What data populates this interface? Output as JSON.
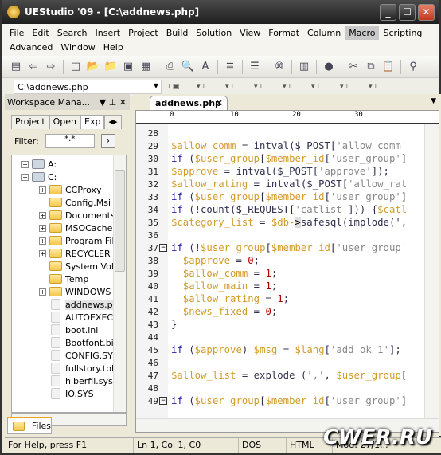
{
  "window": {
    "title": "UEStudio '09 - [C:\\addnews.php]",
    "min": "_",
    "max": "☐",
    "close": "✕"
  },
  "menu": {
    "row1": [
      "File",
      "Edit",
      "Search",
      "Insert",
      "Project",
      "Build",
      "Solution",
      "View",
      "Format",
      "Column",
      "Macro",
      "Scripting"
    ],
    "row2": [
      "Advanced",
      "Window",
      "Help"
    ],
    "active": "Macro"
  },
  "toolbar": {
    "icons": [
      "workspace-icon",
      "back-icon",
      "forward-icon",
      "new-file-icon",
      "open-icon",
      "open-folder-icon",
      "save-icon",
      "save-all-icon",
      "print-icon",
      "print-preview-icon",
      "spell-check-icon",
      "document-icon",
      "wrap-icon",
      "hex-icon",
      "column-icon",
      "web-icon",
      "cut-icon",
      "copy-icon",
      "paste-icon",
      "find-icon"
    ],
    "file_combo": "C:\\addnews.php"
  },
  "workspace": {
    "title": "Workspace Mana...",
    "tabs": [
      "Project",
      "Open",
      "Exp"
    ],
    "filter_label": "Filter:",
    "filter_value": "*.*",
    "tree": [
      {
        "label": "A:",
        "type": "drive",
        "depth": 0,
        "exp": "+"
      },
      {
        "label": "C:",
        "type": "drive",
        "depth": 0,
        "exp": "-"
      },
      {
        "label": "CCProxy",
        "type": "folder",
        "depth": 1,
        "exp": "+"
      },
      {
        "label": "Config.Msi",
        "type": "folder",
        "depth": 1,
        "exp": ""
      },
      {
        "label": "Documents a",
        "type": "folder",
        "depth": 1,
        "exp": "+"
      },
      {
        "label": "MSOCache",
        "type": "folder",
        "depth": 1,
        "exp": "+"
      },
      {
        "label": "Program File",
        "type": "folder",
        "depth": 1,
        "exp": "+"
      },
      {
        "label": "RECYCLER",
        "type": "folder",
        "depth": 1,
        "exp": "+"
      },
      {
        "label": "System Volui",
        "type": "folder",
        "depth": 1,
        "exp": ""
      },
      {
        "label": "Temp",
        "type": "folder",
        "depth": 1,
        "exp": ""
      },
      {
        "label": "WINDOWS",
        "type": "folder",
        "depth": 1,
        "exp": "+"
      },
      {
        "label": "addnews.ph",
        "type": "file",
        "depth": 1,
        "exp": "",
        "selected": true
      },
      {
        "label": "AUTOEXEC.E",
        "type": "file",
        "depth": 1,
        "exp": ""
      },
      {
        "label": "boot.ini",
        "type": "file",
        "depth": 1,
        "exp": ""
      },
      {
        "label": "Bootfont.bin",
        "type": "file",
        "depth": 1,
        "exp": ""
      },
      {
        "label": "CONFIG.SYS",
        "type": "file",
        "depth": 1,
        "exp": ""
      },
      {
        "label": "fullstory.tpl",
        "type": "file",
        "depth": 1,
        "exp": ""
      },
      {
        "label": "hiberfil.sys",
        "type": "file",
        "depth": 1,
        "exp": ""
      },
      {
        "label": "IO.SYS",
        "type": "file",
        "depth": 1,
        "exp": ""
      }
    ],
    "bottom_tab": "Files"
  },
  "editor": {
    "tab": "addnews.php",
    "ruler": [
      "0",
      "10",
      "20",
      "30"
    ],
    "lines": [
      {
        "n": "28",
        "t": []
      },
      {
        "n": "29",
        "t": [
          [
            "$allow_comm",
            "v"
          ],
          [
            " = ",
            "p"
          ],
          [
            "intval($_POST[",
            "p"
          ],
          [
            "'allow_comm'",
            "s"
          ]
        ]
      },
      {
        "n": "30",
        "t": [
          [
            "if",
            "k"
          ],
          [
            " (",
            "p"
          ],
          [
            "$user_group",
            "v"
          ],
          [
            "[",
            "p"
          ],
          [
            "$member_id",
            "v"
          ],
          [
            "[",
            "p"
          ],
          [
            "'user_group'",
            "s"
          ],
          [
            "]",
            "p"
          ]
        ]
      },
      {
        "n": "31",
        "t": [
          [
            "$approve",
            "v"
          ],
          [
            " = ",
            "p"
          ],
          [
            "intval($_POST[",
            "p"
          ],
          [
            "'approve'",
            "s"
          ],
          [
            "]);",
            "p"
          ]
        ]
      },
      {
        "n": "32",
        "t": [
          [
            "$allow_rating",
            "v"
          ],
          [
            " = ",
            "p"
          ],
          [
            "intval($_POST[",
            "p"
          ],
          [
            "'allow_rat",
            "s"
          ]
        ]
      },
      {
        "n": "33",
        "t": [
          [
            "if",
            "k"
          ],
          [
            " (",
            "p"
          ],
          [
            "$user_group",
            "v"
          ],
          [
            "[",
            "p"
          ],
          [
            "$member_id",
            "v"
          ],
          [
            "[",
            "p"
          ],
          [
            "'user_group'",
            "s"
          ],
          [
            "]",
            "p"
          ]
        ]
      },
      {
        "n": "34",
        "t": [
          [
            "if",
            "k"
          ],
          [
            " (!count($_REQUEST[",
            "p"
          ],
          [
            "'catlist'",
            "s"
          ],
          [
            "])) {",
            "p"
          ],
          [
            "$catl",
            "v"
          ]
        ]
      },
      {
        "n": "35",
        "t": [
          [
            "$category_list",
            "v"
          ],
          [
            " = ",
            "p"
          ],
          [
            "$db-",
            "v"
          ],
          [
            ">",
            "hl"
          ],
          [
            "safesql(implode(',",
            "p"
          ]
        ]
      },
      {
        "n": "36",
        "t": []
      },
      {
        "n": "37",
        "fold": true,
        "t": [
          [
            "if",
            "k"
          ],
          [
            " (!",
            "p"
          ],
          [
            "$user_group",
            "v"
          ],
          [
            "[",
            "p"
          ],
          [
            "$member_id",
            "v"
          ],
          [
            "[",
            "p"
          ],
          [
            "'user_group'",
            "s"
          ]
        ]
      },
      {
        "n": "38",
        "t": [
          [
            "  $approve",
            "v"
          ],
          [
            " = ",
            "p"
          ],
          [
            "0",
            "n"
          ],
          [
            ";",
            "p"
          ]
        ]
      },
      {
        "n": "39",
        "t": [
          [
            "  $allow_comm",
            "v"
          ],
          [
            " = ",
            "p"
          ],
          [
            "1",
            "n"
          ],
          [
            ";",
            "p"
          ]
        ]
      },
      {
        "n": "40",
        "t": [
          [
            "  $allow_main",
            "v"
          ],
          [
            " = ",
            "p"
          ],
          [
            "1",
            "n"
          ],
          [
            ";",
            "p"
          ]
        ]
      },
      {
        "n": "41",
        "t": [
          [
            "  $allow_rating",
            "v"
          ],
          [
            " = ",
            "p"
          ],
          [
            "1",
            "n"
          ],
          [
            ";",
            "p"
          ]
        ]
      },
      {
        "n": "42",
        "t": [
          [
            "  $news_fixed",
            "v"
          ],
          [
            " = ",
            "p"
          ],
          [
            "0",
            "n"
          ],
          [
            ";",
            "p"
          ]
        ]
      },
      {
        "n": "43",
        "t": [
          [
            "}",
            "p"
          ]
        ]
      },
      {
        "n": "44",
        "t": []
      },
      {
        "n": "45",
        "t": [
          [
            "if",
            "k"
          ],
          [
            " (",
            "p"
          ],
          [
            "$approve",
            "v"
          ],
          [
            ") ",
            "p"
          ],
          [
            "$msg",
            "v"
          ],
          [
            " = ",
            "p"
          ],
          [
            "$lang",
            "v"
          ],
          [
            "[",
            "p"
          ],
          [
            "'add_ok_1'",
            "s"
          ],
          [
            "];",
            "p"
          ]
        ]
      },
      {
        "n": "46",
        "t": []
      },
      {
        "n": "47",
        "t": [
          [
            "$allow_list",
            "v"
          ],
          [
            " = explode (",
            "p"
          ],
          [
            "','",
            "s"
          ],
          [
            ", ",
            "p"
          ],
          [
            "$user_group",
            "v"
          ],
          [
            "[",
            "p"
          ]
        ]
      },
      {
        "n": "48",
        "t": []
      },
      {
        "n": "49",
        "fold": true,
        "t": [
          [
            "if",
            "k"
          ],
          [
            " (",
            "p"
          ],
          [
            "$user_group",
            "v"
          ],
          [
            "[",
            "p"
          ],
          [
            "$member_id",
            "v"
          ],
          [
            "[",
            "p"
          ],
          [
            "'user_group'",
            "s"
          ],
          [
            "]",
            "p"
          ]
        ]
      }
    ]
  },
  "status": {
    "help": "For Help, press F1",
    "position": "Ln 1, Col 1, C0",
    "line_ending": "DOS",
    "syntax": "HTML",
    "modified": "Mod: 27/1..."
  },
  "watermark": "CWER.RU"
}
